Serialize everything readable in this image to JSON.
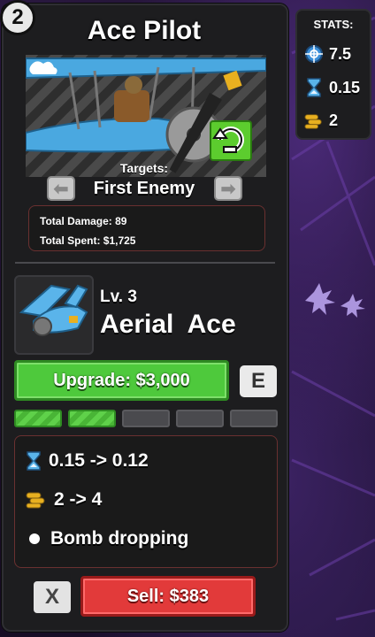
{
  "slot_number": "2",
  "tower": {
    "name": "Ace Pilot",
    "targets_label": "Targets:",
    "target_mode": "First Enemy",
    "totals": {
      "damage": "Total Damage: 89",
      "spent": "Total Spent: $1,725"
    }
  },
  "upgrade": {
    "level": "Lv. 3",
    "name": "Aerial Ace",
    "button_label": "Upgrade: $3,000",
    "hotkey": "E",
    "progress_filled": 2,
    "progress_total": 5,
    "changes": [
      {
        "icon": "hourglass-icon",
        "text": "0.15 -> 0.12"
      },
      {
        "icon": "bullets-icon",
        "text": "2 -> 4"
      },
      {
        "icon": "bullet-point-icon",
        "text": "Bomb dropping"
      }
    ]
  },
  "actions": {
    "close_label": "X",
    "sell_label": "Sell: $383"
  },
  "stats": {
    "title": "STATS:",
    "range": "7.5",
    "cooldown": "0.15",
    "damage": "2"
  },
  "colors": {
    "upgrade_green": "#4ec93c",
    "sell_red": "#e23a3a",
    "panel_bg": "#1d1d1f"
  }
}
